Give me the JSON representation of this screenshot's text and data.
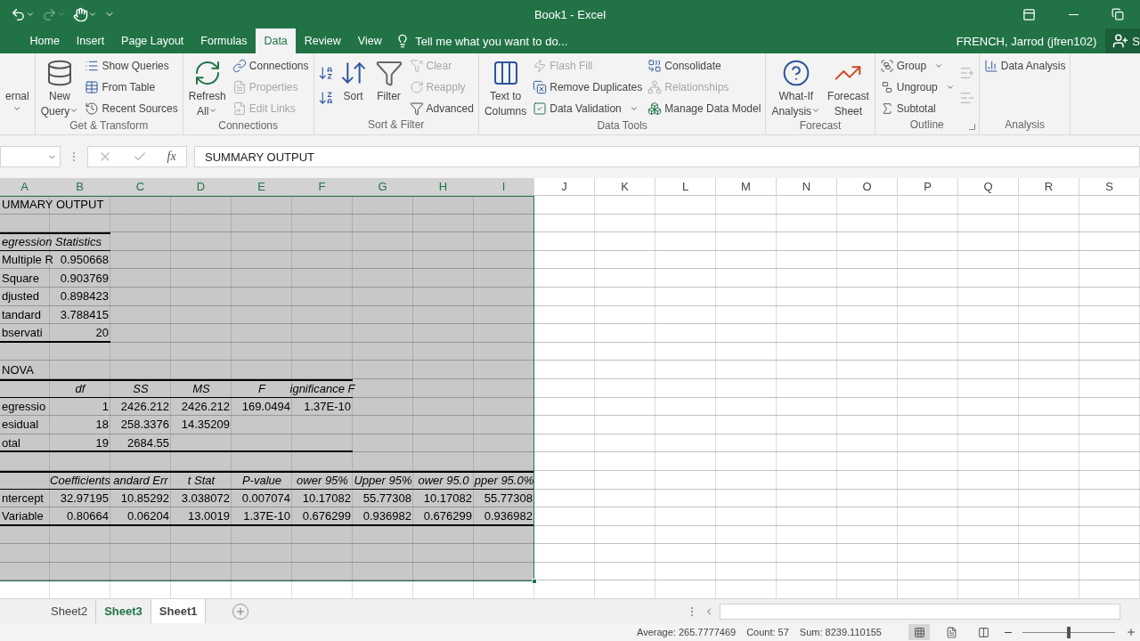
{
  "title_bar": {
    "title": "Book1 - Excel",
    "quick_access": [
      {
        "disabled": false
      },
      {
        "disabled": true
      },
      {
        "disabled": false
      }
    ]
  },
  "tabs": [
    {
      "label": "Home",
      "selected": false
    },
    {
      "label": "Insert",
      "selected": false
    },
    {
      "label": "Page Layout",
      "selected": false
    },
    {
      "label": "Formulas",
      "selected": false
    },
    {
      "label": "Data",
      "selected": true
    },
    {
      "label": "Review",
      "selected": false
    },
    {
      "label": "View",
      "selected": false
    }
  ],
  "tell_me": {
    "placeholder": "Tell me what you want to do..."
  },
  "user": {
    "name": "FRENCH, Jarrod (jfren102)",
    "share": "S"
  },
  "ribbon": [
    {
      "launcher": false,
      "items": [
        {
          "kind": "large",
          "label": [
            "ernal"
          ],
          "dropdown": true,
          "disabled": false
        }
      ]
    },
    {
      "label": "Get & Transform",
      "launcher": false,
      "items": [
        {
          "kind": "large",
          "label": [
            "New",
            "Query"
          ],
          "dropdown": true,
          "disabled": false
        },
        {
          "kind": "small",
          "label": [
            "Show Queries"
          ],
          "dropdown": false,
          "disabled": false
        },
        {
          "kind": "small",
          "label": [
            "From Table"
          ],
          "dropdown": false,
          "disabled": false
        },
        {
          "kind": "small",
          "label": [
            "Recent Sources"
          ],
          "dropdown": false,
          "disabled": false
        }
      ]
    },
    {
      "label": "Connections",
      "launcher": false,
      "items": [
        {
          "kind": "large",
          "label": [
            "Refresh",
            "All"
          ],
          "dropdown": true,
          "disabled": false
        },
        {
          "kind": "small",
          "label": [
            "Connections"
          ],
          "dropdown": false,
          "disabled": false
        },
        {
          "kind": "small",
          "label": [
            "Properties"
          ],
          "dropdown": false,
          "disabled": true
        },
        {
          "kind": "small",
          "label": [
            "Edit Links"
          ],
          "dropdown": false,
          "disabled": true
        }
      ]
    },
    {
      "label": "Sort & Filter",
      "launcher": false,
      "items": [
        {
          "kind": "icon",
          "disabled": false
        },
        {
          "kind": "icon",
          "disabled": false
        },
        {
          "kind": "large",
          "label": [
            "Sort"
          ],
          "dropdown": false,
          "disabled": false
        },
        {
          "kind": "large",
          "label": [
            "Filter"
          ],
          "dropdown": false,
          "disabled": false
        },
        {
          "kind": "small",
          "label": [
            "Clear"
          ],
          "dropdown": false,
          "disabled": true
        },
        {
          "kind": "small",
          "label": [
            "Reapply"
          ],
          "dropdown": false,
          "disabled": true
        },
        {
          "kind": "small",
          "label": [
            "Advanced"
          ],
          "dropdown": false,
          "disabled": false
        }
      ]
    },
    {
      "label": "Data Tools",
      "launcher": false,
      "items": [
        {
          "kind": "large",
          "label": [
            "Text to",
            "Columns"
          ],
          "dropdown": false,
          "disabled": false
        },
        {
          "kind": "small",
          "label": [
            "Flash Fill"
          ],
          "dropdown": false,
          "disabled": true
        },
        {
          "kind": "small",
          "label": [
            "Remove Duplicates"
          ],
          "dropdown": false,
          "disabled": false
        },
        {
          "kind": "small",
          "label": [
            "Data Validation"
          ],
          "dropdown": true,
          "disabled": false
        },
        {
          "kind": "small",
          "label": [
            "Consolidate"
          ],
          "dropdown": false,
          "disabled": false
        },
        {
          "kind": "small",
          "label": [
            "Relationships"
          ],
          "dropdown": false,
          "disabled": true
        },
        {
          "kind": "small",
          "label": [
            "Manage Data Model"
          ],
          "dropdown": false,
          "disabled": false
        }
      ]
    },
    {
      "label": "Forecast",
      "launcher": false,
      "items": [
        {
          "kind": "large",
          "label": [
            "What-If",
            "Analysis"
          ],
          "dropdown": true,
          "disabled": false
        },
        {
          "kind": "large",
          "label": [
            "Forecast",
            "Sheet"
          ],
          "dropdown": false,
          "disabled": false
        }
      ]
    },
    {
      "label": "Outline",
      "launcher": true,
      "items": [
        {
          "kind": "small",
          "label": [
            "Group"
          ],
          "dropdown": true,
          "disabled": false
        },
        {
          "kind": "small",
          "label": [
            "Ungroup"
          ],
          "dropdown": true,
          "disabled": false
        },
        {
          "kind": "small",
          "label": [
            "Subtotal"
          ],
          "dropdown": false,
          "disabled": false
        },
        {
          "kind": "icon",
          "disabled": true
        },
        {
          "kind": "icon",
          "disabled": true
        }
      ]
    },
    {
      "label": "Analysis",
      "launcher": false,
      "items": [
        {
          "kind": "small",
          "label": [
            "Data Analysis"
          ],
          "dropdown": false,
          "disabled": false
        }
      ]
    }
  ],
  "formula_bar": {
    "fx": "fx",
    "formula": "SUMMARY OUTPUT"
  },
  "columns": [
    {
      "label": "A",
      "selected": true
    },
    {
      "label": "B",
      "selected": true
    },
    {
      "label": "C",
      "selected": true
    },
    {
      "label": "D",
      "selected": true
    },
    {
      "label": "E",
      "selected": true
    },
    {
      "label": "F",
      "selected": true
    },
    {
      "label": "G",
      "selected": true
    },
    {
      "label": "H",
      "selected": true
    },
    {
      "label": "I",
      "selected": true
    },
    {
      "label": "J",
      "selected": false
    },
    {
      "label": "K",
      "selected": false
    },
    {
      "label": "L",
      "selected": false
    },
    {
      "label": "M",
      "selected": false
    },
    {
      "label": "N",
      "selected": false
    },
    {
      "label": "O",
      "selected": false
    },
    {
      "label": "P",
      "selected": false
    },
    {
      "label": "Q",
      "selected": false
    },
    {
      "label": "R",
      "selected": false
    },
    {
      "label": "S",
      "selected": false
    }
  ],
  "rows": [
    {
      "kind": "title",
      "selected": true,
      "label": "UMMARY OUTPUT"
    },
    {
      "kind": "blank",
      "selected": true
    },
    {
      "kind": "header",
      "selected": true,
      "label": "egression Statistics"
    },
    {
      "kind": "data",
      "selected": true,
      "label": "Multiple R",
      "values": [
        "0.950668"
      ]
    },
    {
      "kind": "data",
      "selected": true,
      "label": "Square",
      "values": [
        "0.903769"
      ]
    },
    {
      "kind": "data",
      "selected": true,
      "label": "djusted",
      "values": [
        "0.898423"
      ]
    },
    {
      "kind": "data",
      "selected": true,
      "label": "tandard",
      "values": [
        "3.788415"
      ]
    },
    {
      "kind": "last",
      "selected": true,
      "label": "bservati",
      "values": [
        "20"
      ]
    },
    {
      "kind": "blank",
      "selected": true
    },
    {
      "kind": "title",
      "selected": true,
      "label": "NOVA"
    },
    {
      "kind": "header",
      "selected": true,
      "values": [
        "df",
        "SS",
        "MS",
        "F",
        "ignificance F"
      ]
    },
    {
      "kind": "data",
      "selected": true,
      "label": "egressio",
      "values": [
        "1",
        "2426.212",
        "2426.212",
        "169.0494",
        "1.37E-10"
      ]
    },
    {
      "kind": "data",
      "selected": true,
      "label": "esidual",
      "values": [
        "18",
        "258.3376",
        "14.35209"
      ]
    },
    {
      "kind": "last",
      "selected": true,
      "label": "otal",
      "values": [
        "19",
        "2684.55"
      ]
    },
    {
      "kind": "blank",
      "selected": true
    },
    {
      "kind": "header",
      "selected": true,
      "values": [
        "Coefficients",
        "andard Err",
        "t Stat",
        "P-value",
        "ower 95%",
        "Upper 95%",
        "ower 95.0",
        "pper 95.0%"
      ]
    },
    {
      "kind": "data",
      "selected": true,
      "label": "ntercept",
      "values": [
        "32.97195",
        "10.85292",
        "3.038072",
        "0.007074",
        "10.17082",
        "55.77308",
        "10.17082",
        "55.77308"
      ]
    },
    {
      "kind": "last",
      "selected": true,
      "label": "Variable",
      "values": [
        "0.80664",
        "0.06204",
        "13.0019",
        "1.37E-10",
        "0.676299",
        "0.936982",
        "0.676299",
        "0.936982"
      ]
    },
    {
      "kind": "blank",
      "selected": true
    },
    {
      "kind": "blank",
      "selected": true
    },
    {
      "kind": "blank",
      "selected": true
    },
    {
      "kind": "blank",
      "selected": false
    }
  ],
  "sheets": [
    {
      "label": "Sheet2",
      "selected": false,
      "highlighted": false
    },
    {
      "label": "Sheet3",
      "selected": false,
      "highlighted": true
    },
    {
      "label": "Sheet1",
      "selected": true,
      "highlighted": false
    }
  ],
  "status_bar": {
    "average": "Average: 265.7777469",
    "count": "Count: 57",
    "sum": "Sum: 8239.110155",
    "views": [
      {
        "selected": true
      },
      {
        "selected": false
      },
      {
        "selected": false
      }
    ],
    "zoom": {
      "level": 0.5
    }
  }
}
